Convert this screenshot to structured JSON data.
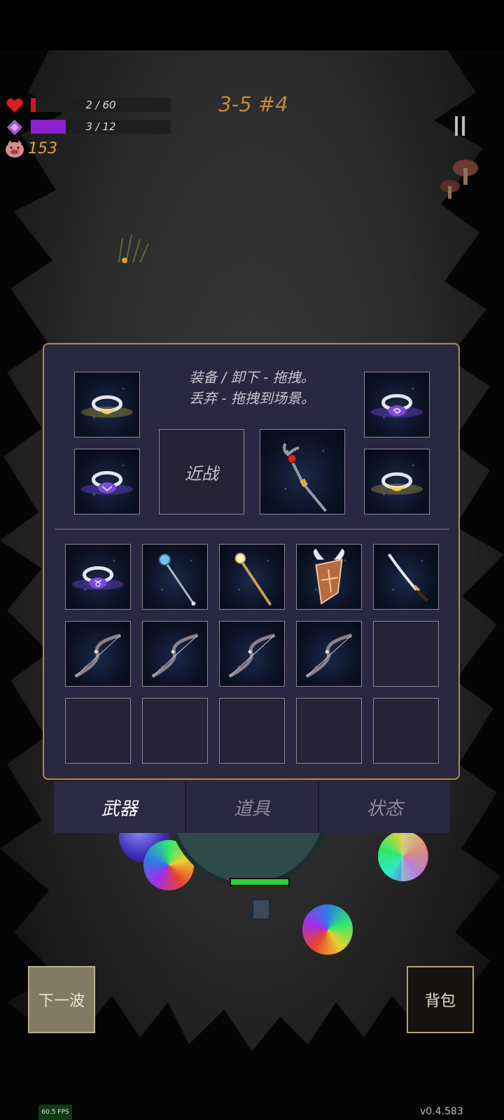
{
  "hud": {
    "hp_text": "2 / 60",
    "hp_fraction": 0.033,
    "mana_text": "3 / 12",
    "mana_fraction": 0.25,
    "coins": "153",
    "wave": "3-5 #4",
    "icons": [
      "heart-icon",
      "mana-crystal-icon",
      "pig-coin-icon",
      "pause-icon"
    ],
    "colors": {
      "hp": "#c41c1c",
      "mana": "#8d1fcf",
      "gold": "#d4a23c"
    }
  },
  "inventory": {
    "hint_line1": "装备 / 卸下 - 拖拽。",
    "hint_line2": "丢弃 - 拖拽到场景。",
    "melee_label": "近战",
    "equipped": [
      "gold-ring",
      "spiral-ring",
      "purple-ring",
      "weapon-staff",
      "gold-ring"
    ],
    "bag_items": [
      "taurus-ring",
      "ice-mace-staff",
      "golden-staff",
      "winged-shield",
      "katana",
      "bow",
      "bow",
      "bow",
      "bow",
      "empty",
      "empty",
      "empty",
      "empty",
      "empty",
      "empty"
    ]
  },
  "tabs": [
    "武器",
    "道具",
    "状态"
  ],
  "active_tab": 0,
  "buttons": {
    "next_wave": "下一波",
    "bag": "背包"
  },
  "footer": {
    "fps": "60.5 FPS",
    "version": "v0.4.583"
  }
}
